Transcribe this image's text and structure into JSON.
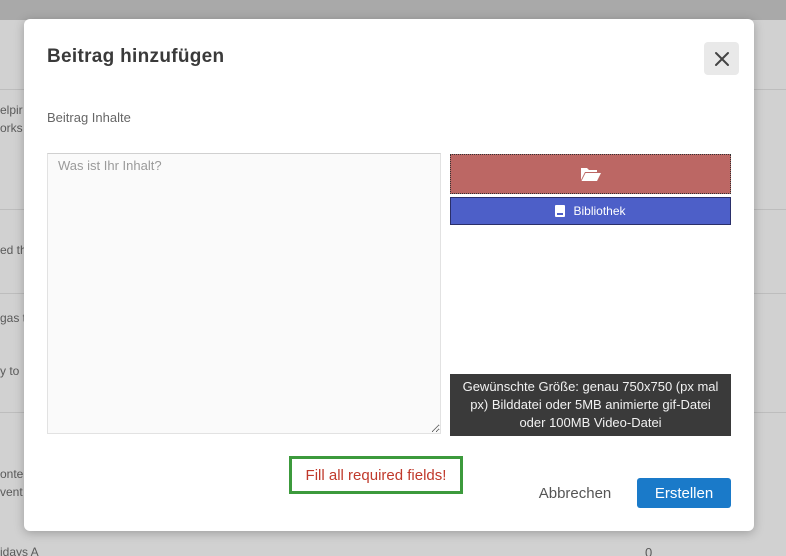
{
  "background": {
    "snippets": [
      "elpir",
      "orks",
      "ed th",
      "gas t",
      "y to",
      "onte",
      "vent",
      "idays A"
    ],
    "number": "0"
  },
  "modal": {
    "title": "Beitrag hinzufügen",
    "close_icon": "close-icon",
    "section_label": "Beitrag Inhalte",
    "content_placeholder": "Was ist Ihr Inhalt?",
    "content_value": "",
    "upload_icon": "folder-open-icon",
    "library_icon": "book-icon",
    "library_label": "Bibliothek",
    "size_hint": "Gewünschte Größe: genau 750x750 (px mal px) Bilddatei oder 5MB animierte gif-Datei oder 100MB Video-Datei",
    "error_message": "Fill all required fields!",
    "cancel_label": "Abbrechen",
    "create_label": "Erstellen"
  },
  "colors": {
    "upload_button": "#bc6764",
    "library_button": "#4d5fc8",
    "create_button": "#1a7ac9",
    "error_text": "#c0392b",
    "error_border": "#3c9a3c"
  }
}
